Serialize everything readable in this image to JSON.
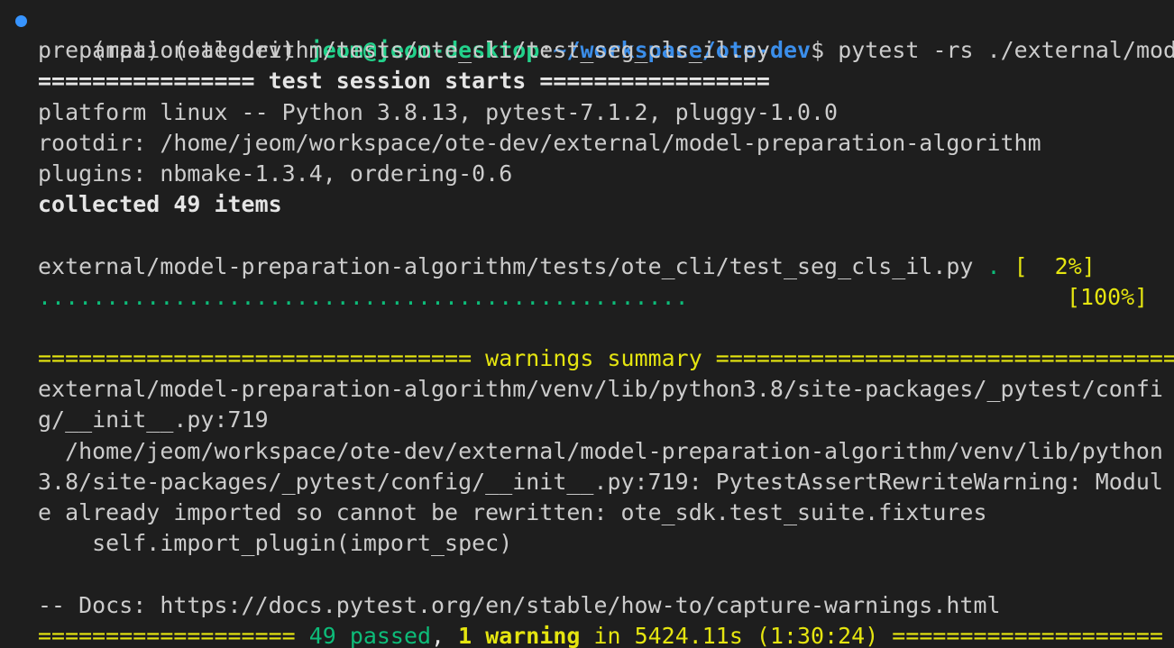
{
  "prompt": {
    "env1": "(mpa)",
    "env2": "(ote-dev)",
    "user_host": "jeom@jeom-desktop",
    "colon": ":",
    "path": "~/workspace/ote-dev",
    "dollar": "$",
    "command_part1": " pytest -rs ./external/model-",
    "command_part2": "preparation-algorithm/tests/ote_cli/test_seg_cls_il.py"
  },
  "session": {
    "sep_left": "================",
    "title": " test session starts ",
    "sep_right": "=================",
    "platform": "platform linux -- Python 3.8.13, pytest-7.1.2, pluggy-1.0.0",
    "rootdir": "rootdir: /home/jeom/workspace/ote-dev/external/model-preparation-algorithm",
    "plugins": "plugins: nbmake-1.3.4, ordering-0.6",
    "collected": "collected 49 items"
  },
  "progress": {
    "test_file": "external/model-preparation-algorithm/tests/ote_cli/test_seg_cls_il.py",
    "dot1": " .",
    "pct1": " [  2%]",
    "dots2": "................................................",
    "pct2": "[100%]"
  },
  "warnings": {
    "sep_left": "================================",
    "title": " warnings summary ",
    "sep_right": "===================================",
    "line1": "external/model-preparation-algorithm/venv/lib/python3.8/site-packages/_pytest/confi",
    "line2": "g/__init__.py:719",
    "line3": "  /home/jeom/workspace/ote-dev/external/model-preparation-algorithm/venv/lib/python",
    "line4": "3.8/site-packages/_pytest/config/__init__.py:719: PytestAssertRewriteWarning: Modul",
    "line5": "e already imported so cannot be rewritten: ote_sdk.test_suite.fixtures",
    "line6": "    self.import_plugin(import_spec)",
    "docs": "-- Docs: https://docs.pytest.org/en/stable/how-to/capture-warnings.html"
  },
  "summary": {
    "sep_left": "===================",
    "passed": " 49 passed",
    "comma": ",",
    "warning": " 1 warning",
    "time": " in 5424.11s (1:30:24) ",
    "sep_right": "===================="
  },
  "colors": {
    "background": "#1e1e1e",
    "text": "#cccccc",
    "green": "#23d18b",
    "blue": "#3b8eea",
    "yellow": "#e5e510",
    "marker": "#3794ff"
  }
}
